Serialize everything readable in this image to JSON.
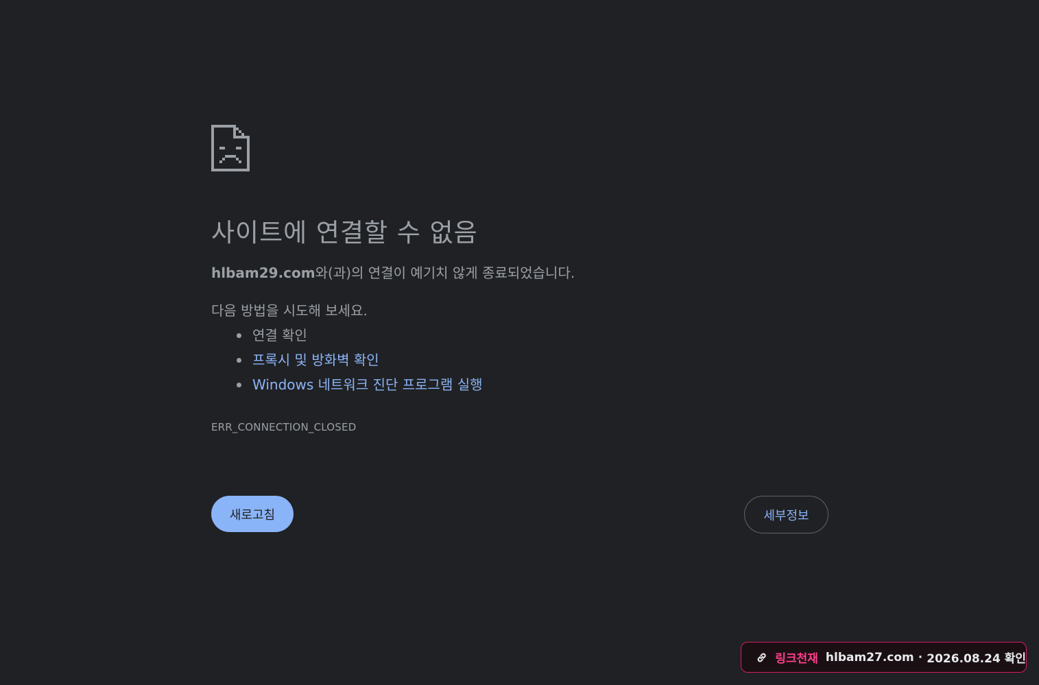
{
  "icons": {
    "error_page": "sad-page-icon",
    "badge": "link-icon"
  },
  "colors": {
    "background": "#202124",
    "text": "#9aa0a6",
    "link": "#8ab4f8",
    "primary_button": "#8ab4f8",
    "badge_accent": "#ff3d8a"
  },
  "error": {
    "title": "사이트에 연결할 수 없음",
    "host": "hlbam29.com",
    "description_suffix": "와(과)의 연결이 예기치 않게 종료되었습니다.",
    "try_heading": "다음 방법을 시도해 보세요.",
    "suggestions": [
      {
        "label": "연결 확인",
        "link": false
      },
      {
        "label": "프록시 및 방화벽 확인",
        "link": true
      },
      {
        "label": "Windows 네트워크 진단 프로그램 실행",
        "link": true
      }
    ],
    "code": "ERR_CONNECTION_CLOSED"
  },
  "buttons": {
    "reload": "새로고침",
    "details": "세부정보"
  },
  "badge": {
    "brand": "링크천재",
    "domain": "hlbam27.com",
    "separator": "·",
    "date": "2026.08.24 확인"
  }
}
